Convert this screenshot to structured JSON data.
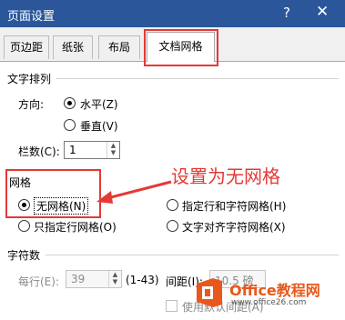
{
  "window": {
    "title": "页面设置",
    "help": "?",
    "close": "✕"
  },
  "tabs": [
    {
      "label": "页边距",
      "active": false
    },
    {
      "label": "纸张",
      "active": false
    },
    {
      "label": "布局",
      "active": false
    },
    {
      "label": "文档网格",
      "active": true
    }
  ],
  "text_direction": {
    "heading": "文字排列",
    "direction_label": "方向:",
    "horizontal": "水平(Z)",
    "vertical": "垂直(V)",
    "selected": "horizontal",
    "columns_label": "栏数(C):",
    "columns_value": "1"
  },
  "grid": {
    "heading": "网格",
    "options": [
      {
        "label": "无网格(N)",
        "checked": true
      },
      {
        "label": "指定行和字符网格(H)",
        "checked": false
      },
      {
        "label": "只指定行网格(O)",
        "checked": false
      },
      {
        "label": "文字对齐字符网格(X)",
        "checked": false
      }
    ]
  },
  "annotation": {
    "text": "设置为无网格",
    "color": "#e53935"
  },
  "chars": {
    "heading": "字符数",
    "per_line_label": "每行(E):",
    "per_line_value": "39",
    "range": "(1-43)",
    "pitch_label": "间距(I):",
    "pitch_value": "10.5 磅",
    "default_label": "使用默认间距(A)"
  },
  "watermark": {
    "brand": "Office教程网",
    "url": "www.office26.com"
  },
  "colors": {
    "titlebar": "#2b579a",
    "highlight": "#e53935",
    "watermark": "#e8581c"
  }
}
